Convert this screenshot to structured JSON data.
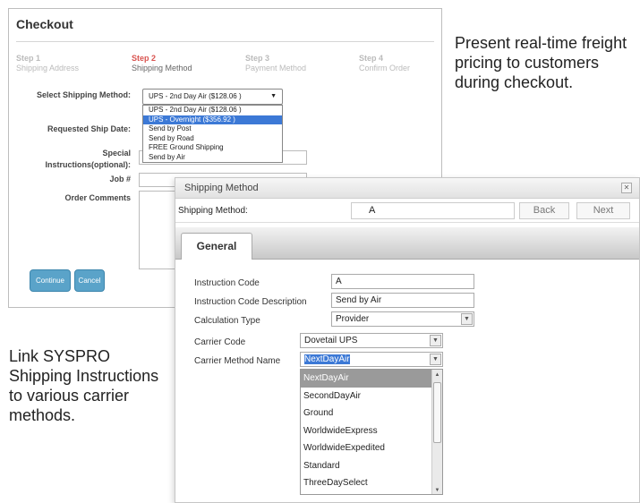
{
  "checkout": {
    "title": "Checkout",
    "steps": [
      {
        "num": "Step 1",
        "label": "Shipping Address"
      },
      {
        "num": "Step 2",
        "label": "Shipping Method"
      },
      {
        "num": "Step 3",
        "label": "Payment Method"
      },
      {
        "num": "Step 4",
        "label": "Confirm Order"
      }
    ],
    "labels": {
      "select_shipping": "Select Shipping Method:",
      "requested_ship_date": "Requested Ship Date:",
      "special": "Special",
      "instructions": "Instructions(optional):",
      "job": "Job #",
      "order_comments": "Order Comments"
    },
    "shipping_select": {
      "value": "UPS - 2nd Day Air ($128.06 )",
      "options": [
        "UPS - 2nd Day Air ($128.06 )",
        "UPS - Overnight ($356.92 )",
        "Send by Post",
        "Send by Road",
        "FREE Ground Shipping",
        "Send by Air"
      ],
      "highlighted": "UPS - Overnight ($356.92 )"
    },
    "buttons": {
      "continue": "Continue",
      "cancel": "Cancel"
    }
  },
  "captions": {
    "top_right": "Present real-time freight pricing to customers during checkout.",
    "bottom_left": "Link SYSPRO Shipping Instructions to various carrier methods."
  },
  "shipping_window": {
    "title": "Shipping Method",
    "toolbar": {
      "label": "Shipping Method:",
      "value": "A",
      "back": "Back",
      "next": "Next"
    },
    "tab": "General",
    "fields": {
      "instruction_code": {
        "label": "Instruction Code",
        "value": "A"
      },
      "instruction_desc": {
        "label": "Instruction Code Description",
        "value": "Send by Air"
      },
      "calculation_type": {
        "label": "Calculation Type",
        "value": "Provider"
      },
      "carrier_code": {
        "label": "Carrier Code",
        "value": "Dovetail UPS"
      },
      "carrier_method": {
        "label": "Carrier Method Name",
        "value": "NextDayAir"
      }
    },
    "carrier_methods": [
      "NextDayAir",
      "SecondDayAir",
      "Ground",
      "WorldwideExpress",
      "WorldwideExpedited",
      "Standard",
      "ThreeDaySelect"
    ]
  },
  "colors": {
    "step_active": "#d9534f",
    "button": "#5aa3c9",
    "highlight": "#3c79d6"
  }
}
